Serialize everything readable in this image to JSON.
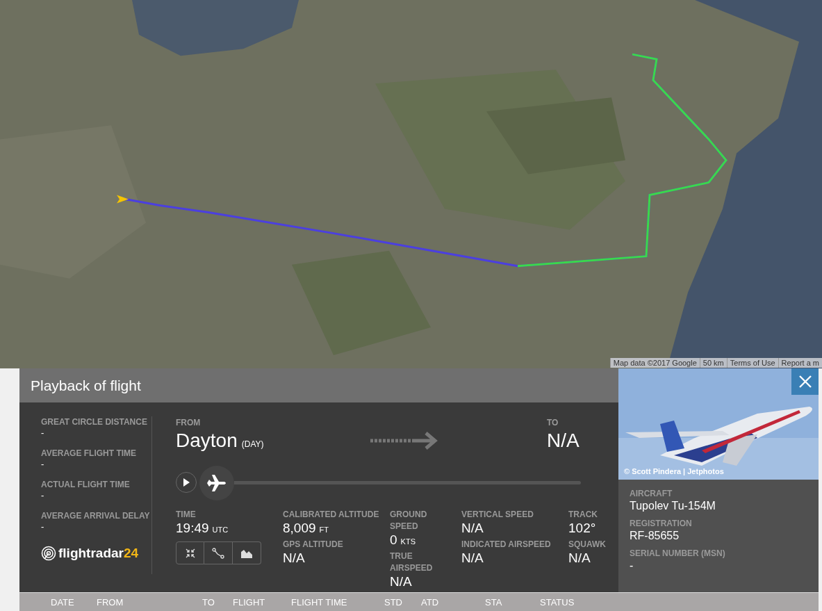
{
  "map": {
    "attribution": [
      "Map data ©2017 Google",
      "50 km",
      "Terms of Use",
      "Report a m"
    ]
  },
  "panel": {
    "title": "Playback of flight",
    "summary": [
      {
        "label": "GREAT CIRCLE DISTANCE",
        "value": "-"
      },
      {
        "label": "AVERAGE FLIGHT TIME",
        "value": "-"
      },
      {
        "label": "ACTUAL FLIGHT TIME",
        "value": "-"
      },
      {
        "label": "AVERAGE ARRIVAL DELAY",
        "value": "-"
      }
    ],
    "logo": {
      "text": "flightradar",
      "suffix": "24"
    },
    "from": {
      "label": "FROM",
      "city": "Dayton",
      "code": "(DAY)"
    },
    "to": {
      "label": "TO",
      "city": "N/A"
    },
    "playback": {
      "level": 0
    },
    "stats": [
      [
        {
          "label": "TIME",
          "value": "19:49",
          "unit": "UTC"
        }
      ],
      [
        {
          "label": "CALIBRATED ALTITUDE",
          "value": "8,009",
          "unit": "FT"
        },
        {
          "label": "GPS ALTITUDE",
          "value": "N/A"
        }
      ],
      [
        {
          "label": "GROUND SPEED",
          "value": "0",
          "unit": "KTS"
        },
        {
          "label": "TRUE AIRSPEED",
          "value": "N/A"
        }
      ],
      [
        {
          "label": "VERTICAL SPEED",
          "value": "N/A"
        },
        {
          "label": "INDICATED AIRSPEED",
          "value": "N/A"
        }
      ],
      [
        {
          "label": "TRACK",
          "value": "102°"
        },
        {
          "label": "SQUAWK",
          "value": "N/A"
        }
      ]
    ],
    "tools": [
      {
        "kind": "collapse"
      },
      {
        "kind": "route"
      },
      {
        "kind": "graph"
      }
    ]
  },
  "aircraft": {
    "photo_credit": "© Scott Pindera | Jetphotos",
    "details": [
      {
        "label": "AIRCRAFT",
        "value": "Tupolev Tu-154M"
      },
      {
        "label": "REGISTRATION",
        "value": "RF-85655"
      },
      {
        "label": "SERIAL NUMBER (MSN)",
        "value": "-"
      }
    ]
  },
  "table": {
    "columns": [
      "DATE",
      "FROM",
      "TO",
      "FLIGHT",
      "FLIGHT TIME",
      "STD",
      "ATD",
      "STA",
      "STATUS"
    ]
  }
}
